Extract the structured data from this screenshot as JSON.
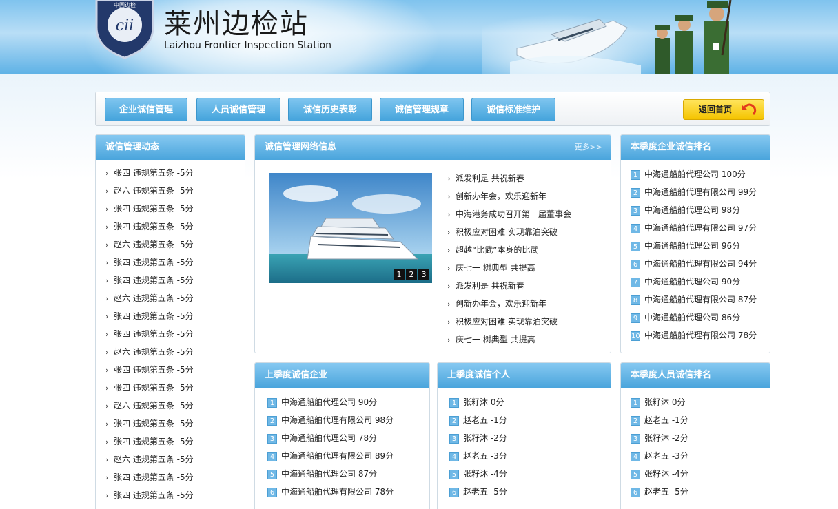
{
  "header": {
    "title": "莱州边检站",
    "subtitle": "Laizhou Frontier Inspection Station"
  },
  "nav": {
    "items": [
      "企业诚信管理",
      "人员诚信管理",
      "诚信历史表彰",
      "诚信管理规章",
      "诚信标准维护"
    ],
    "home": "返回首页"
  },
  "dynamics": {
    "title": "诚信管理动态",
    "items": [
      "张四 违规第五条 -5分",
      "赵六 违规第五条 -5分",
      "张四 违规第五条 -5分",
      "张四 违规第五条 -5分",
      "赵六 违规第五条 -5分",
      "张四 违规第五条 -5分",
      "张四 违规第五条 -5分",
      "赵六 违规第五条 -5分",
      "张四 违规第五条 -5分",
      "张四 违规第五条 -5分",
      "赵六 违规第五条 -5分",
      "张四 违规第五条 -5分",
      "张四 违规第五条 -5分",
      "赵六 违规第五条 -5分",
      "张四 违规第五条 -5分",
      "张四 违规第五条 -5分",
      "赵六 违规第五条 -5分",
      "张四 违规第五条 -5分",
      "张四 违规第五条 -5分"
    ]
  },
  "network": {
    "title": "诚信管理网络信息",
    "more": "更多>>",
    "slide_pages": [
      "1",
      "2",
      "3"
    ],
    "items": [
      "派发利是 共祝新春",
      "创新办年会，欢乐迎新年",
      "中海港务成功召开第一届董事会",
      "积极应对困难 实现靠泊突破",
      "超越“比武”本身的比武",
      "庆七一 树典型 共提高",
      "派发利是 共祝新春",
      "创新办年会，欢乐迎新年",
      "积极应对困难 实现靠泊突破",
      "庆七一 树典型 共提高"
    ]
  },
  "company_rank": {
    "title": "本季度企业诚信排名",
    "items": [
      {
        "n": "1",
        "text": "中海通船舶代理公司 100分"
      },
      {
        "n": "2",
        "text": "中海通船舶代理有限公司 99分"
      },
      {
        "n": "3",
        "text": "中海通船舶代理公司 98分"
      },
      {
        "n": "4",
        "text": "中海通船舶代理有限公司 97分"
      },
      {
        "n": "5",
        "text": "中海通船舶代理公司 96分"
      },
      {
        "n": "6",
        "text": "中海通船舶代理有限公司 94分"
      },
      {
        "n": "7",
        "text": "中海通船舶代理公司 90分"
      },
      {
        "n": "8",
        "text": "中海通船舶代理有限公司 87分"
      },
      {
        "n": "9",
        "text": "中海通船舶代理公司 86分"
      },
      {
        "n": "10",
        "text": "中海通船舶代理有限公司 78分"
      }
    ]
  },
  "last_company": {
    "title": "上季度诚信企业",
    "items": [
      {
        "n": "1",
        "text": "中海通船舶代理公司 90分"
      },
      {
        "n": "2",
        "text": "中海通船舶代理有限公司 98分"
      },
      {
        "n": "3",
        "text": "中海通船舶代理公司 78分"
      },
      {
        "n": "4",
        "text": "中海通船舶代理有限公司 89分"
      },
      {
        "n": "5",
        "text": "中海通船舶代理公司 87分"
      },
      {
        "n": "6",
        "text": "中海通船舶代理有限公司 78分"
      }
    ]
  },
  "last_person": {
    "title": "上季度诚信个人",
    "items": [
      {
        "n": "1",
        "text": "张籽沐 0分"
      },
      {
        "n": "2",
        "text": "赵老五 -1分"
      },
      {
        "n": "3",
        "text": "张籽沐 -2分"
      },
      {
        "n": "4",
        "text": "赵老五 -3分"
      },
      {
        "n": "5",
        "text": "张籽沐 -4分"
      },
      {
        "n": "6",
        "text": "赵老五 -5分"
      }
    ]
  },
  "person_rank": {
    "title": "本季度人员诚信排名",
    "items": [
      {
        "n": "1",
        "text": "张籽沐 0分"
      },
      {
        "n": "2",
        "text": "赵老五 -1分"
      },
      {
        "n": "3",
        "text": "张籽沐 -2分"
      },
      {
        "n": "4",
        "text": "赵老五 -3分"
      },
      {
        "n": "5",
        "text": "张籽沐 -4分"
      },
      {
        "n": "6",
        "text": "赵老五 -5分"
      }
    ]
  }
}
